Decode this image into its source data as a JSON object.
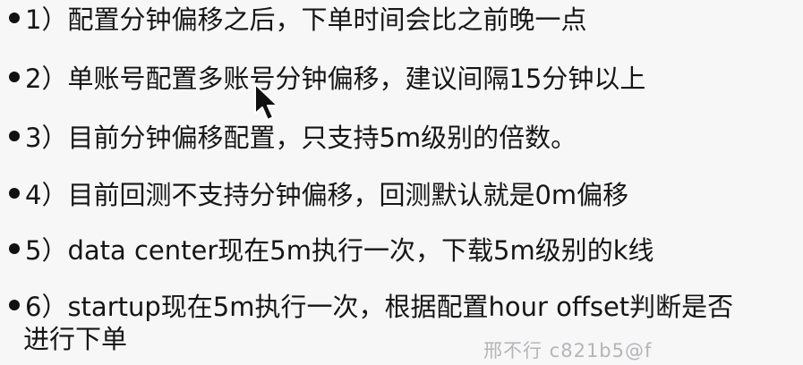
{
  "notes": [
    {
      "bullet": "•",
      "text": "1）配置分钟偏移之后，下单时间会比之前晚一点"
    },
    {
      "bullet": "•",
      "text": "2）单账号配置多账号分钟偏移，建议间隔15分钟以上"
    },
    {
      "bullet": "•",
      "text": "3）目前分钟偏移配置，只支持5m级别的倍数。"
    },
    {
      "bullet": "•",
      "text": "4）目前回测不支持分钟偏移，回测默认就是0m偏移"
    },
    {
      "bullet": "•",
      "text": "5）data center现在5m执行一次，下载5m级别的k线"
    },
    {
      "bullet": "•",
      "text": "6）startup现在5m执行一次，根据配置hour offset判断是否",
      "continuation": "进行下单"
    }
  ],
  "watermark": "邢不行 c821b5@f",
  "icons": {
    "cursor": "mouse-pointer-icon"
  }
}
